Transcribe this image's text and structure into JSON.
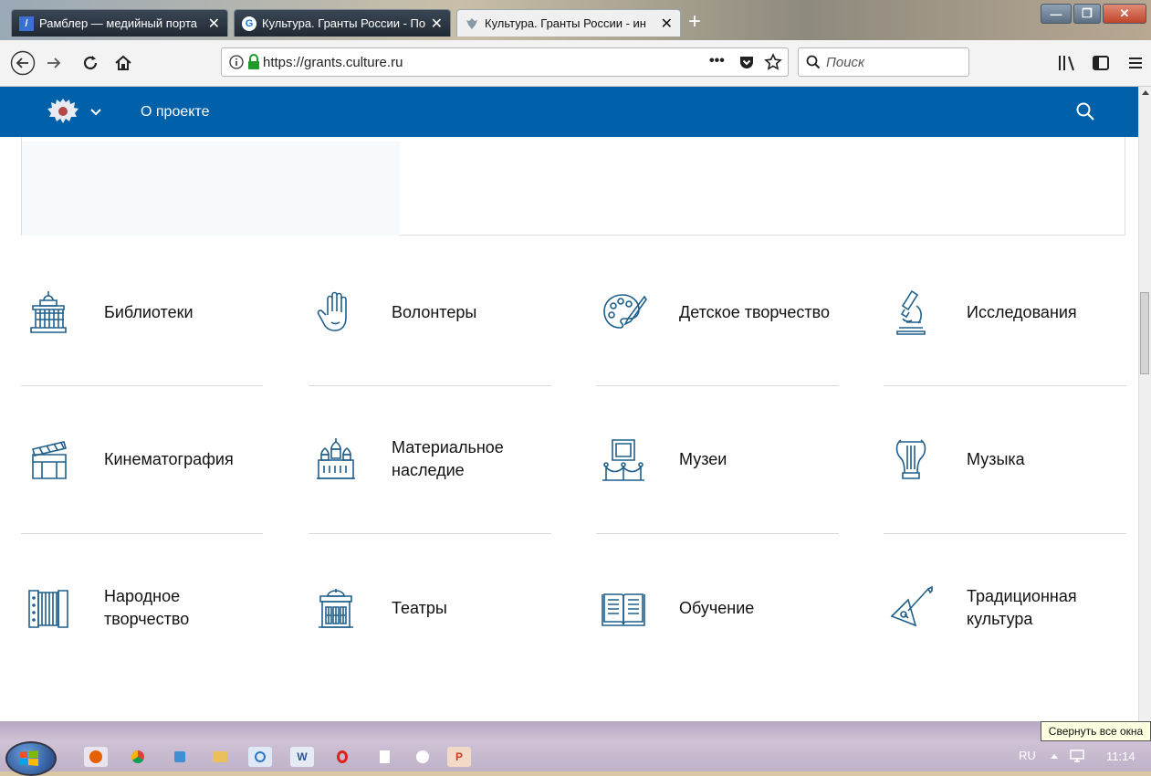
{
  "browser": {
    "tabs": [
      {
        "favicon": "/",
        "title": "Рамблер — медийный порта",
        "close": "✕"
      },
      {
        "favicon": "G",
        "title": "Культура. Гранты России - По",
        "close": "✕"
      },
      {
        "favicon": "",
        "title": "Культура. Гранты России - ин",
        "close": "✕"
      }
    ],
    "new_tab": "+",
    "window_buttons": {
      "minimize": "—",
      "maximize": "❐",
      "close": "✕"
    },
    "url": "https://grants.culture.ru",
    "page_actions": "•••",
    "search_placeholder": "Поиск"
  },
  "site": {
    "nav_about": "О проекте"
  },
  "categories": [
    {
      "label": "Библиотеки",
      "icon": "library-icon"
    },
    {
      "label": "Волонтеры",
      "icon": "hand-icon"
    },
    {
      "label": "Детское творчество",
      "icon": "palette-icon"
    },
    {
      "label": "Исследования",
      "icon": "microscope-icon"
    },
    {
      "label": "Кинематография",
      "icon": "clapperboard-icon"
    },
    {
      "label": "Материальное наследие",
      "icon": "cathedral-icon"
    },
    {
      "label": "Музеи",
      "icon": "museum-exhibit-icon"
    },
    {
      "label": "Музыка",
      "icon": "lyre-icon"
    },
    {
      "label": "Народное творчество",
      "icon": "accordion-icon"
    },
    {
      "label": "Театры",
      "icon": "theatre-icon"
    },
    {
      "label": "Обучение",
      "icon": "book-icon"
    },
    {
      "label": "Традиционная культура",
      "icon": "balalaika-icon"
    }
  ],
  "taskbar": {
    "tooltip": "Свернуть все окна",
    "language": "RU",
    "time": "11:14"
  },
  "colors": {
    "site_header": "#0061aa",
    "icon_stroke": "#1f5f8b"
  }
}
